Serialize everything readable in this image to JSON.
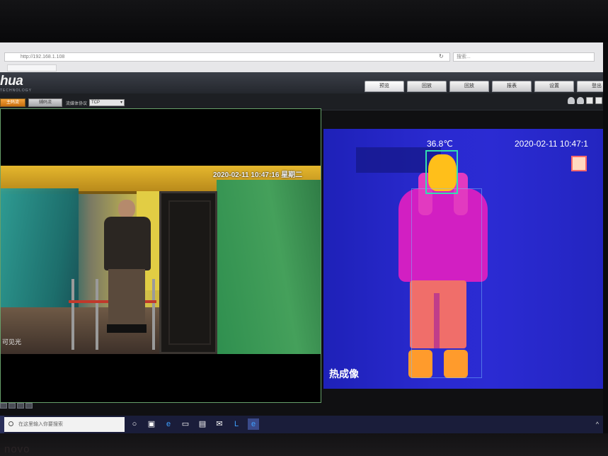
{
  "browser": {
    "url": "http://192.168.1.108",
    "search_placeholder": "搜索...",
    "tab_label": ""
  },
  "header": {
    "logo": "hua",
    "logo_sub": "TECHNOLOGY",
    "nav_tabs": [
      {
        "label": "预览",
        "active": true
      },
      {
        "label": "回放",
        "active": false
      },
      {
        "label": "回放",
        "active": false
      },
      {
        "label": "报表",
        "active": false
      },
      {
        "label": "设置",
        "active": false
      },
      {
        "label": "登出",
        "active": false
      }
    ]
  },
  "toolbar": {
    "primary_button": "主码流",
    "secondary_button": "辅码流",
    "protocol_label": "流媒体协议",
    "protocol_value": "TCP"
  },
  "visible_video": {
    "osd_timestamp": "2020-02-11 10:47:16 星期二",
    "label": "可见光"
  },
  "thermal_video": {
    "temperature": "36.8℃",
    "osd_timestamp": "2020-02-11 10:47:1",
    "label": "热成像"
  },
  "taskbar": {
    "search_placeholder": "在这里输入你要搜索",
    "tray": "^"
  },
  "bezel": {
    "brand": "novo"
  }
}
